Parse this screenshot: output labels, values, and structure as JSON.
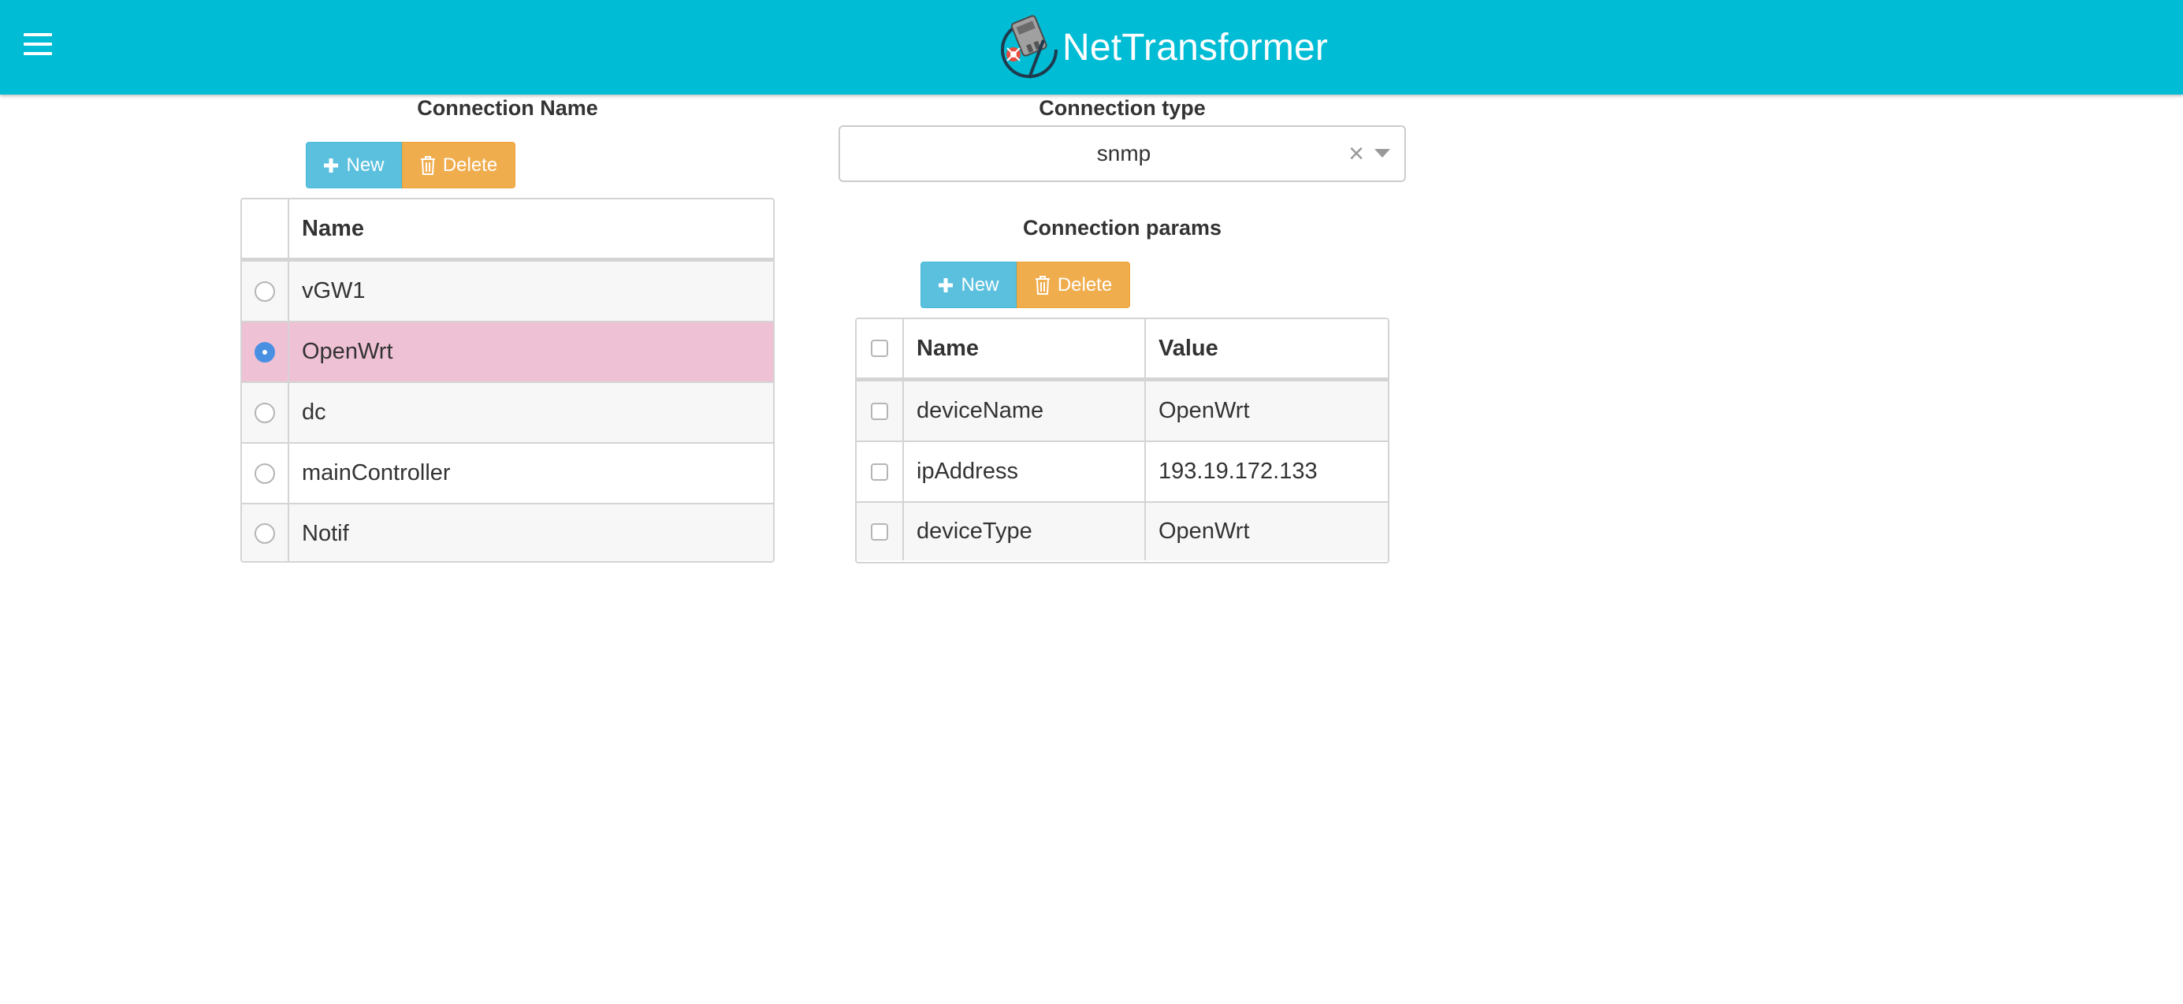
{
  "app": {
    "brand_name": "NetTransformer",
    "accent_color": "#00bcd4",
    "menu_icon": "hamburger-menu-icon",
    "logo_icon": "nettransformer-logo"
  },
  "connection_name": {
    "title": "Connection Name",
    "new_label": "New",
    "new_icon": "plus-icon",
    "delete_label": "Delete",
    "delete_icon": "trash-icon",
    "column_header": "Name",
    "selected_index": 1,
    "selected_row_color": "#efc1d5",
    "rows": [
      {
        "name": "vGW1"
      },
      {
        "name": "OpenWrt"
      },
      {
        "name": "dc"
      },
      {
        "name": "mainController"
      },
      {
        "name": "Notif"
      }
    ]
  },
  "connection_type": {
    "title": "Connection type",
    "selected_value": "snmp",
    "clear_icon": "clear-x-icon",
    "dropdown_icon": "caret-down-icon"
  },
  "connection_params": {
    "title": "Connection params",
    "new_label": "New",
    "new_icon": "plus-icon",
    "delete_label": "Delete",
    "delete_icon": "trash-icon",
    "columns": [
      "Name",
      "Value"
    ],
    "rows": [
      {
        "name": "deviceName",
        "value": "OpenWrt"
      },
      {
        "name": "ipAddress",
        "value": "193.19.172.133"
      },
      {
        "name": "deviceType",
        "value": "OpenWrt"
      }
    ]
  }
}
